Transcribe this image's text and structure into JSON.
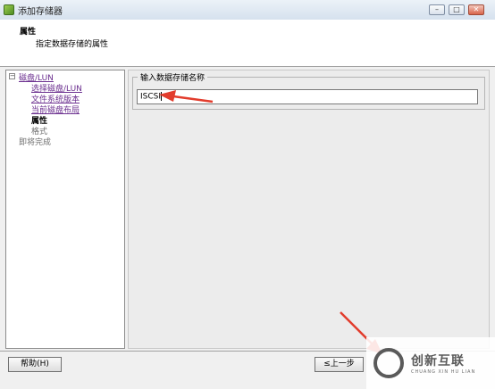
{
  "window": {
    "title": "添加存储器",
    "minimize": "–",
    "maximize": "□",
    "close": "✕"
  },
  "header": {
    "title": "属性",
    "subtitle": "指定数据存储的属性"
  },
  "nav": {
    "expander": "−",
    "items": [
      {
        "label": "磁盘/LUN",
        "state": "link"
      },
      {
        "label": "选择磁盘/LUN",
        "state": "link"
      },
      {
        "label": "文件系统版本",
        "state": "link"
      },
      {
        "label": "当前磁盘布局",
        "state": "link"
      },
      {
        "label": "属性",
        "state": "current"
      },
      {
        "label": "格式",
        "state": "disabled"
      },
      {
        "label": "即将完成",
        "state": "disabled"
      }
    ]
  },
  "form": {
    "legend": "输入数据存储名称",
    "datastore_name": "ISCSI"
  },
  "buttons": {
    "help": "帮助(H)",
    "back": "≤上一步"
  },
  "watermark": {
    "text": "创新互联",
    "sub": "CHUANG XIN HU LIAN"
  },
  "colors": {
    "annotation_arrow": "#e23c2c",
    "link": "#6b2f8f"
  }
}
